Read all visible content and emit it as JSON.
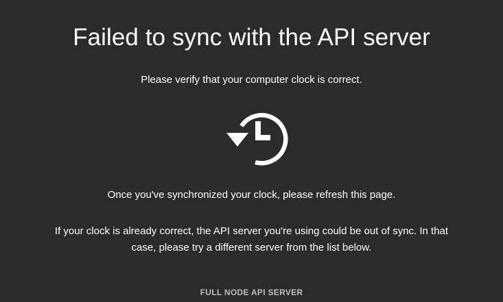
{
  "error": {
    "title": "Failed to sync with the API server",
    "subtitle": "Please verify that your computer clock is correct.",
    "icon": "history-clock-icon",
    "message_refresh": "Once you've synchronized your clock, please refresh this page.",
    "message_server": "If your clock is already correct, the API server you're using could be out of sync. In that case, please try a different server from the list below."
  },
  "server_list": {
    "label": "FULL NODE API SERVER"
  },
  "colors": {
    "background": "#2b2b2b",
    "text": "#ffffff",
    "muted_text": "#bdbdbd"
  }
}
